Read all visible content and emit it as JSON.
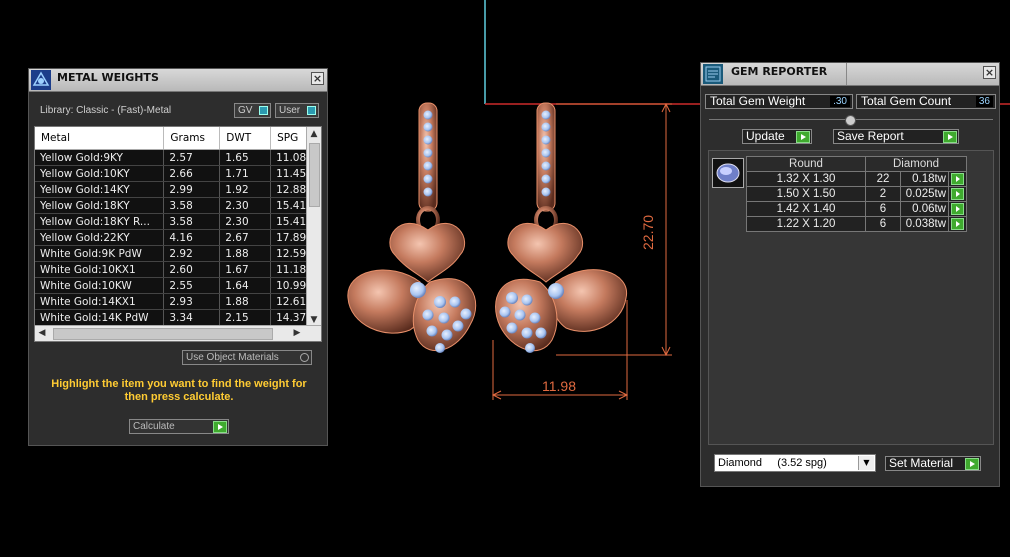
{
  "viewport": {
    "dim_width": "11.98",
    "dim_height": "22.70"
  },
  "metal_weights": {
    "title": "METAL WEIGHTS",
    "close": "×",
    "library_label": "Library: Classic - (Fast)-Metal",
    "gv_label": "GV",
    "user_label": "User",
    "columns": [
      "Metal",
      "Grams",
      "DWT",
      "SPG"
    ],
    "rows": [
      [
        "Yellow Gold:9KY",
        "2.57",
        "1.65",
        "11.08"
      ],
      [
        "Yellow Gold:10KY",
        "2.66",
        "1.71",
        "11.45"
      ],
      [
        "Yellow Gold:14KY",
        "2.99",
        "1.92",
        "12.88"
      ],
      [
        "Yellow Gold:18KY",
        "3.58",
        "2.30",
        "15.41"
      ],
      [
        "Yellow Gold:18KY R...",
        "3.58",
        "2.30",
        "15.41"
      ],
      [
        "Yellow Gold:22KY",
        "4.16",
        "2.67",
        "17.89"
      ],
      [
        "White Gold:9K PdW",
        "2.92",
        "1.88",
        "12.59"
      ],
      [
        "White Gold:10KX1",
        "2.60",
        "1.67",
        "11.18"
      ],
      [
        "White Gold:10KW",
        "2.55",
        "1.64",
        "10.99"
      ],
      [
        "White Gold:14KX1",
        "2.93",
        "1.88",
        "12.61"
      ],
      [
        "White Gold:14K PdW",
        "3.34",
        "2.15",
        "14.37"
      ]
    ],
    "use_object_materials": "Use Object Materials",
    "hint": "Highlight the item you want to find the weight for then press calculate.",
    "calculate": "Calculate"
  },
  "gem_reporter": {
    "title": "GEM REPORTER",
    "close": "×",
    "total_weight_label": "Total Gem Weight",
    "total_weight_value": ".30",
    "total_count_label": "Total Gem Count",
    "total_count_value": "36",
    "update": "Update",
    "save_report": "Save Report",
    "table_headers": [
      "Round",
      "",
      "Diamond"
    ],
    "rows": [
      [
        "1.32 X 1.30",
        "22",
        "0.18tw"
      ],
      [
        "1.50 X 1.50",
        "2",
        "0.025tw"
      ],
      [
        "1.42 X 1.40",
        "6",
        "0.06tw"
      ],
      [
        "1.22 X 1.20",
        "6",
        "0.038tw"
      ]
    ],
    "material_select": "Diamond     (3.52 spg)",
    "set_material": "Set Material"
  },
  "colors": {
    "accent_hint": "#ffcc33",
    "dimension": "#e06a40",
    "metal": "#c47a5e",
    "gem": "#a8c4f0",
    "button_green": "#3faa2e"
  }
}
